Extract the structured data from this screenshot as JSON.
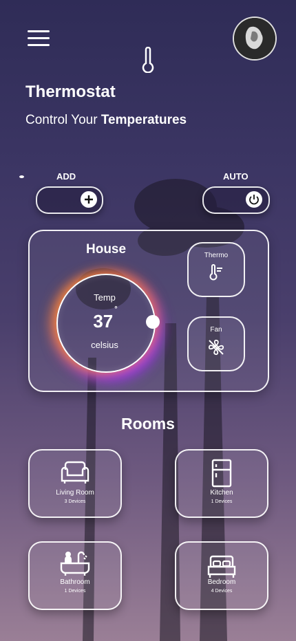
{
  "header": {
    "title": "Thermostat",
    "subtitle_prefix": "Control Your ",
    "subtitle_bold": "Temperatures"
  },
  "icons": {
    "menu": "hamburger-menu-icon",
    "top": "thermometer-icon",
    "add": "plus-icon",
    "auto": "power-icon",
    "thermo": "thermometer-lines-icon",
    "fan": "fan-off-icon"
  },
  "controls": {
    "add_label": "ADD",
    "auto_label": "AUTO"
  },
  "house": {
    "title": "House",
    "temp_label": "Temp",
    "temp_value": "37",
    "degree": "°",
    "unit": "celsius",
    "thermo_label": "Thermo",
    "fan_label": "Fan"
  },
  "rooms": {
    "title": "Rooms",
    "items": [
      {
        "name": "Living Room",
        "devices": "3 Devices",
        "icon": "sofa-icon"
      },
      {
        "name": "Kitchen",
        "devices": "1 Devices",
        "icon": "fridge-icon"
      },
      {
        "name": "Bathroom",
        "devices": "1 Devices",
        "icon": "bathtub-icon"
      },
      {
        "name": "Bedroom",
        "devices": "4 Devices",
        "icon": "bed-icon"
      }
    ]
  },
  "colors": {
    "glow_orange": "#ff8c28",
    "glow_purple": "#aa3cff",
    "card_border": "#ffffff"
  }
}
